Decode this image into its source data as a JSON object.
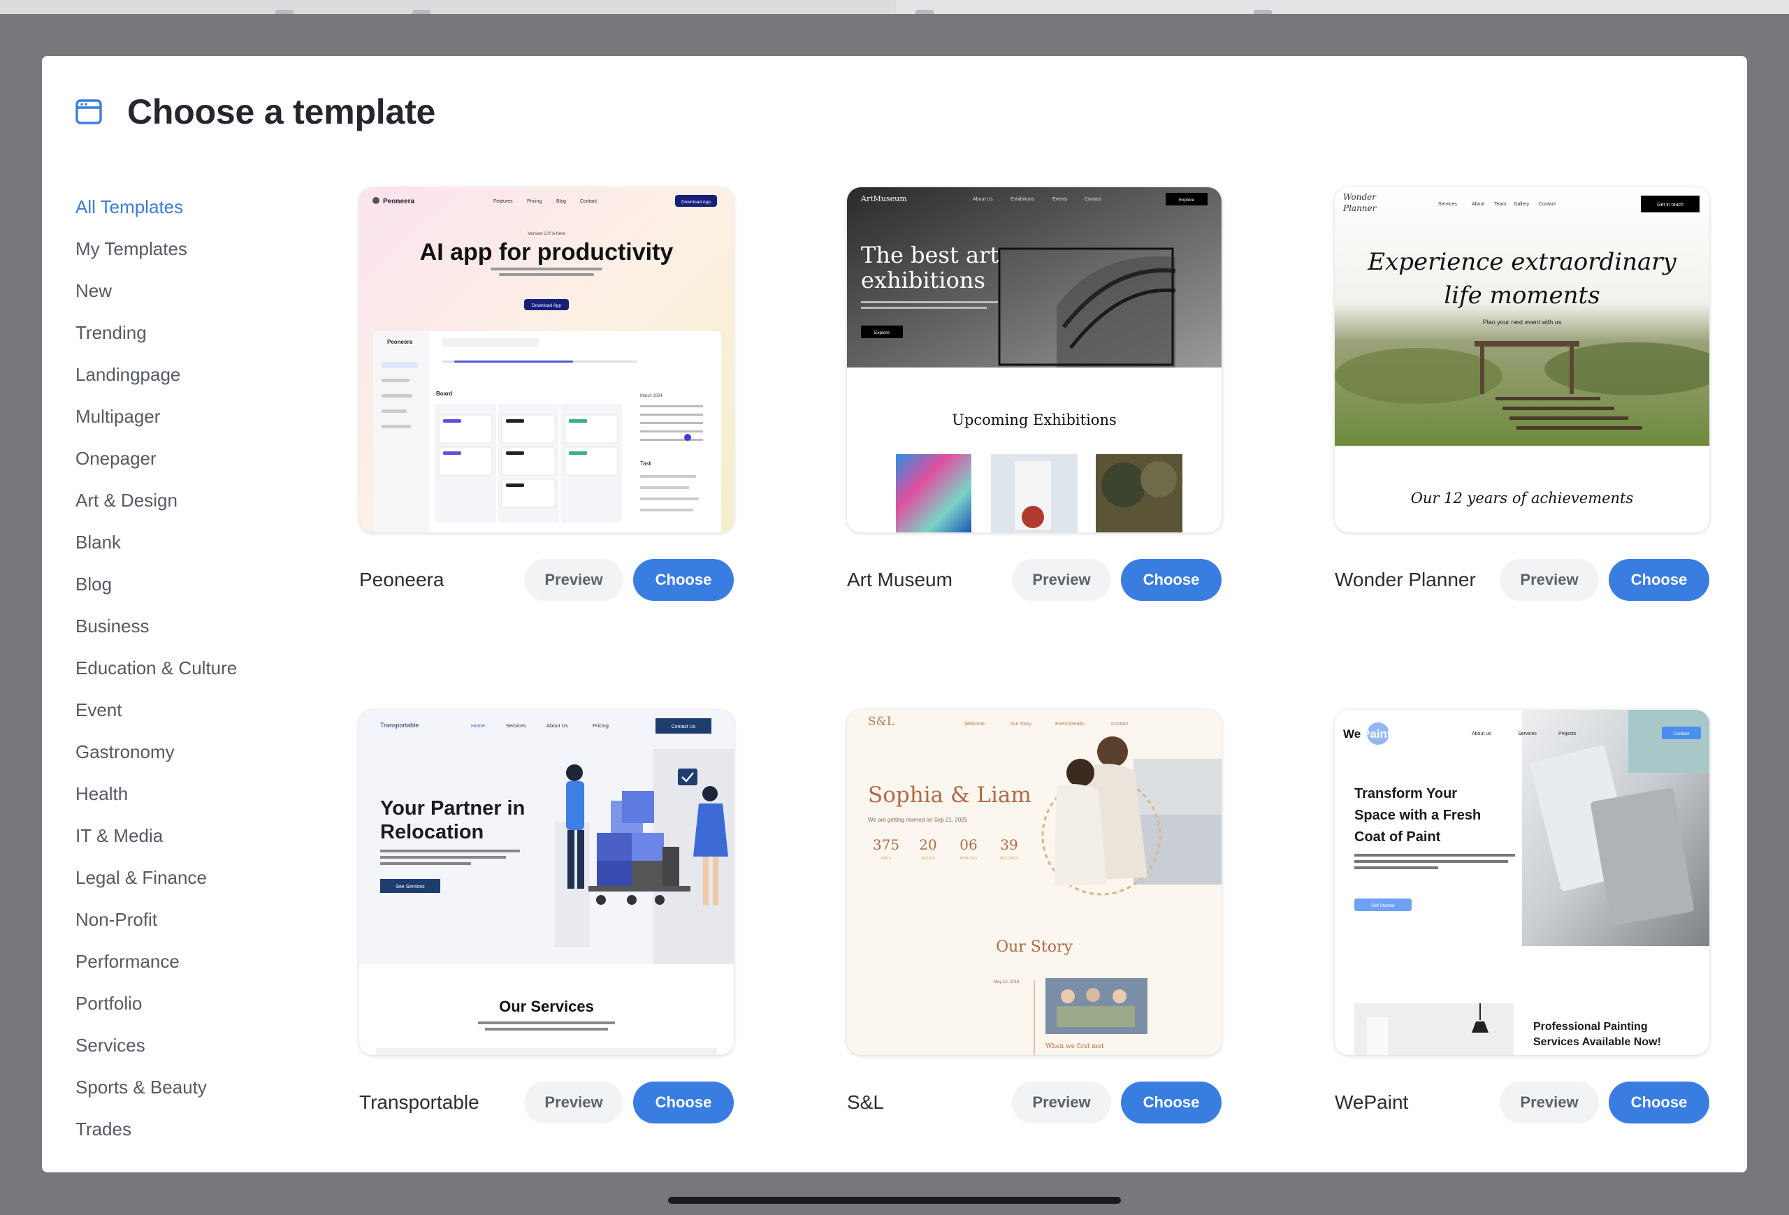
{
  "modal": {
    "title": "Choose a template"
  },
  "sidebar": {
    "items": [
      {
        "label": "All Templates",
        "active": true
      },
      {
        "label": "My Templates"
      },
      {
        "label": "New"
      },
      {
        "label": "Trending"
      },
      {
        "label": "Landingpage"
      },
      {
        "label": "Multipager"
      },
      {
        "label": "Onepager"
      },
      {
        "label": "Art & Design"
      },
      {
        "label": "Blank"
      },
      {
        "label": "Blog"
      },
      {
        "label": "Business"
      },
      {
        "label": "Education & Culture"
      },
      {
        "label": "Event"
      },
      {
        "label": "Gastronomy"
      },
      {
        "label": "Health"
      },
      {
        "label": "IT & Media"
      },
      {
        "label": "Legal & Finance"
      },
      {
        "label": "Non-Profit"
      },
      {
        "label": "Performance"
      },
      {
        "label": "Portfolio"
      },
      {
        "label": "Services"
      },
      {
        "label": "Sports & Beauty"
      },
      {
        "label": "Trades"
      }
    ]
  },
  "buttons": {
    "preview": "Preview",
    "choose": "Choose"
  },
  "templates": [
    {
      "name": "Peoneera",
      "thumb": {
        "logo": "Peoneera",
        "nav": [
          "Features",
          "Pricing",
          "Blog",
          "Contact"
        ],
        "cta": "Download App",
        "version": "Version 2.0 is here",
        "headline": "AI app for productivity",
        "hero_button": "Download App",
        "board_label": "Board",
        "task_label": "Task",
        "month": "March 2024"
      }
    },
    {
      "name": "Art Museum",
      "thumb": {
        "logo": "ArtMuseum",
        "nav": [
          "About Us",
          "Exhibitions",
          "Events",
          "Contact"
        ],
        "cta": "Explore",
        "headline_1": "The best art",
        "headline_2": "exhibitions",
        "hero_button": "Explore",
        "section": "Upcoming Exhibitions"
      }
    },
    {
      "name": "Wonder Planner",
      "thumb": {
        "logo_1": "Wonder",
        "logo_2": "Planner",
        "nav": [
          "Services",
          "About",
          "Team",
          "Gallery",
          "Contact"
        ],
        "cta": "Get in touch",
        "headline_1": "Experience extraordinary",
        "headline_2": "life moments",
        "subline": "Plan your next event with us",
        "section": "Our 12 years of achievements"
      }
    },
    {
      "name": "Transportable",
      "thumb": {
        "logo": "Transportable",
        "nav": [
          "Home",
          "Services",
          "About Us",
          "Pricing"
        ],
        "cta": "Contact Us",
        "headline_1": "Your Partner in",
        "headline_2": "Relocation",
        "hero_button": "See Services",
        "section": "Our Services"
      }
    },
    {
      "name": "S&L",
      "thumb": {
        "logo": "S&L",
        "nav": [
          "Welcome",
          "Our Story",
          "Event Details",
          "Contact"
        ],
        "headline": "Sophia & Liam",
        "subline": "We are getting married on Sep 21, 2025",
        "countdown": [
          {
            "value": "375",
            "unit": "DAYS"
          },
          {
            "value": "20",
            "unit": "HOURS"
          },
          {
            "value": "06",
            "unit": "MINUTES"
          },
          {
            "value": "39",
            "unit": "SECONDS"
          }
        ],
        "section": "Our Story",
        "date": "May 12, 2019",
        "caption": "When we first met"
      }
    },
    {
      "name": "WePaint",
      "thumb": {
        "logo_a": "We",
        "logo_b": "Paint",
        "nav": [
          "About us",
          "Services",
          "Projects"
        ],
        "cta": "Contact",
        "headline_1": "Transform Your",
        "headline_2": "Space with a Fresh",
        "headline_3": "Coat of Paint",
        "hero_button": "Get Started",
        "section_1": "Professional Painting",
        "section_2": "Services Available Now!"
      }
    }
  ],
  "colors": {
    "accent": "#3a7de0",
    "active_category": "#3a7dd6",
    "backdrop": "#77787c"
  }
}
